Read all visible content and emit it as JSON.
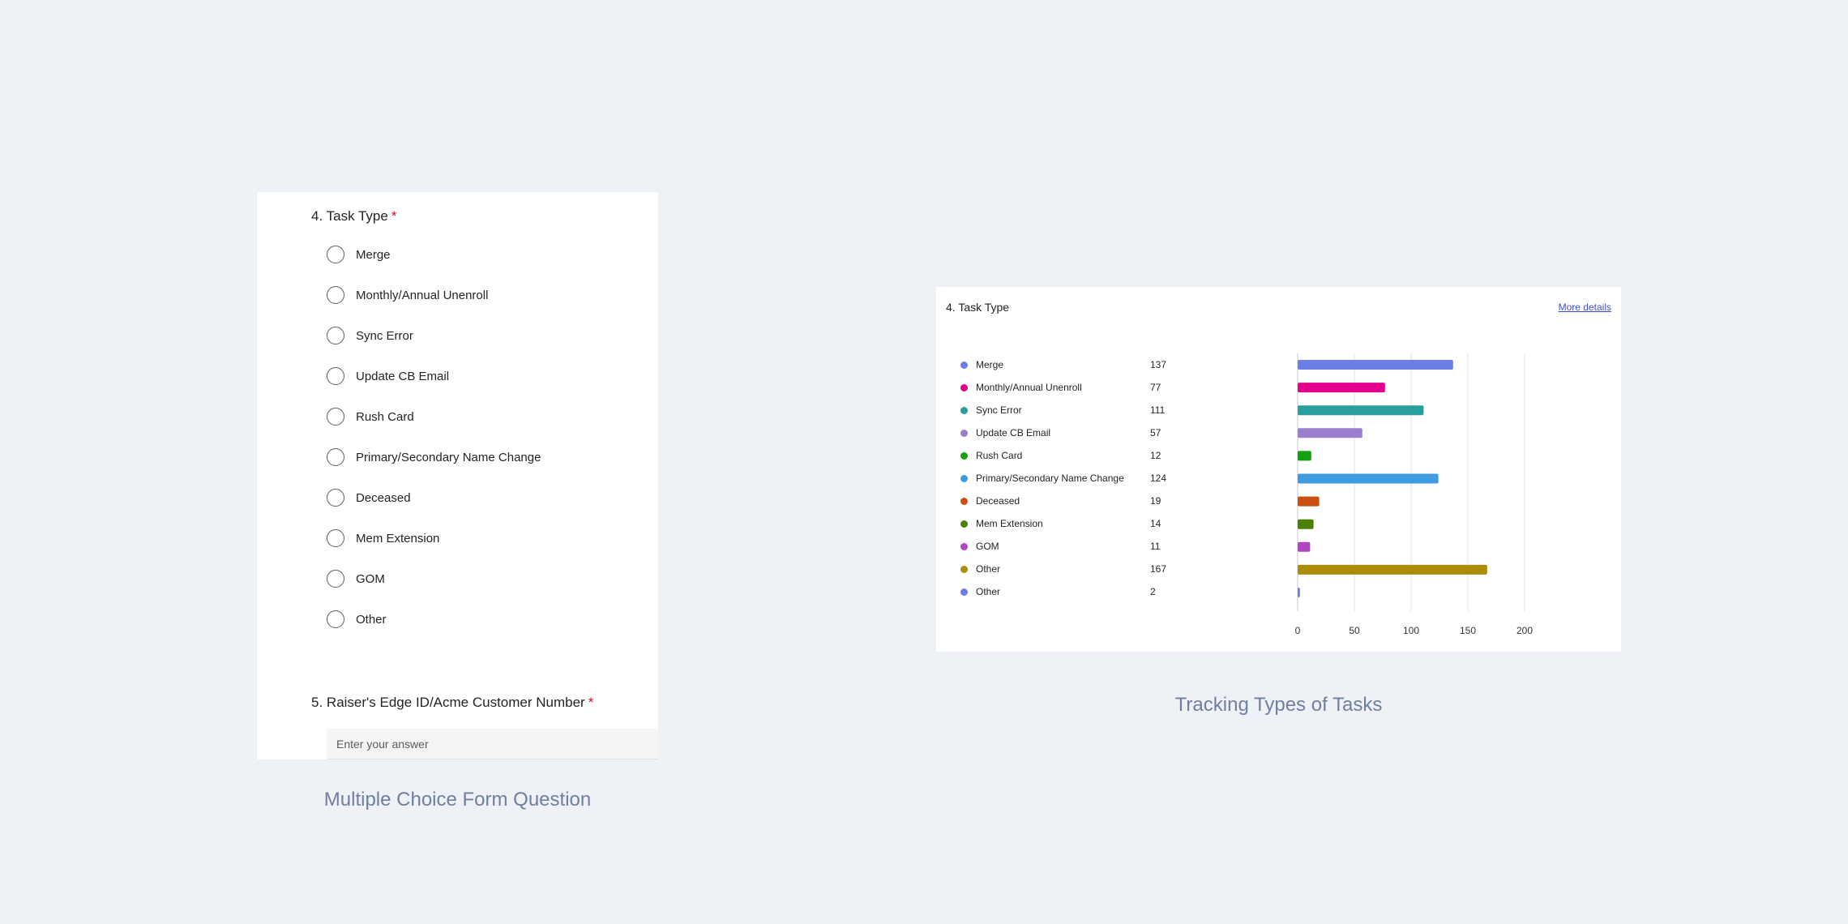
{
  "form": {
    "q4": {
      "number": "4.",
      "title": "Task Type",
      "required_mark": "*"
    },
    "options": [
      "Merge",
      "Monthly/Annual Unenroll",
      "Sync Error",
      "Update CB Email",
      "Rush Card",
      "Primary/Secondary Name Change",
      "Deceased",
      "Mem Extension",
      "GOM",
      "Other"
    ],
    "q5": {
      "number": "5.",
      "title": "Raiser's Edge ID/Acme Customer Number",
      "required_mark": "*"
    },
    "answer_placeholder": "Enter your answer",
    "caption": "Multiple Choice Form Question"
  },
  "chart_panel": {
    "title": "4. Task Type",
    "more_details": "More details",
    "caption": "Tracking Types of Tasks"
  },
  "chart_data": {
    "type": "bar",
    "orientation": "horizontal",
    "title": "4. Task Type",
    "categories": [
      "Merge",
      "Monthly/Annual Unenroll",
      "Sync Error",
      "Update CB Email",
      "Rush Card",
      "Primary/Secondary Name Change",
      "Deceased",
      "Mem Extension",
      "GOM",
      "Other",
      "Other"
    ],
    "values": [
      137,
      77,
      111,
      57,
      12,
      124,
      19,
      14,
      11,
      167,
      2
    ],
    "colors": [
      "#6b7fe6",
      "#e3008c",
      "#2a9d9e",
      "#9b7fcc",
      "#13a10e",
      "#3f9be0",
      "#ca5010",
      "#498205",
      "#b146c2",
      "#ac8c00",
      "#6b7fe6"
    ],
    "xlim": [
      0,
      200
    ],
    "xticks": [
      0,
      50,
      100,
      150,
      200
    ],
    "grid": true,
    "legend_placement": "left"
  }
}
